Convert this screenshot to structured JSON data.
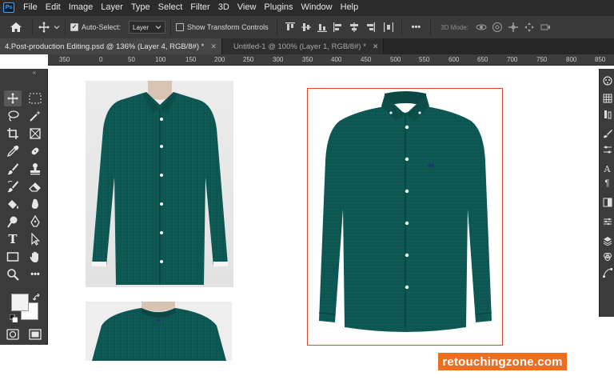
{
  "menubar": {
    "app_logo": "Ps",
    "items": [
      "File",
      "Edit",
      "Image",
      "Layer",
      "Type",
      "Select",
      "Filter",
      "3D",
      "View",
      "Plugins",
      "Window",
      "Help"
    ]
  },
  "options": {
    "auto_select_label": "Auto-Select:",
    "auto_select_checked": true,
    "auto_select_target": "Layer",
    "show_transform_label": "Show Transform Controls",
    "show_transform_checked": false,
    "more_label": "•••",
    "mode_3d_label": "3D Mode:"
  },
  "tabs": [
    {
      "title": "4.Post-production Editing.psd @ 136% (Layer 4, RGB/8#) *",
      "active": true
    },
    {
      "title": "Untitled-1 @ 100% (Layer 1, RGB/8#) *",
      "active": false
    }
  ],
  "ruler": {
    "ticks": [
      "350",
      "0",
      "50",
      "100",
      "150",
      "200",
      "250",
      "300",
      "350",
      "400",
      "450",
      "500",
      "550",
      "600",
      "650",
      "700",
      "750",
      "800",
      "850"
    ]
  },
  "toolbar": {
    "collapse_label": "«",
    "tools": [
      "move-tool",
      "marquee-tool",
      "lasso-tool",
      "magic-wand-tool",
      "crop-tool",
      "frame-tool",
      "eyedropper-tool",
      "healing-brush-tool",
      "brush-tool",
      "clone-stamp-tool",
      "history-brush-tool",
      "eraser-tool",
      "paint-bucket-tool",
      "smudge-tool",
      "dodge-tool",
      "pen-tool",
      "type-tool",
      "path-selection-tool",
      "rectangle-tool",
      "hand-tool",
      "zoom-tool",
      "more-tools"
    ],
    "more_tools_label": "•••",
    "type_tool_label": "T"
  },
  "colors": {
    "shirt": "#0f5a55",
    "shirt_dark": "#0a403c",
    "selection_frame": "#e0472d",
    "brand_badge": "#ee6e1f",
    "ps_blue": "#31a8ff"
  },
  "watermark": {
    "text": "retouchingzone.com"
  }
}
